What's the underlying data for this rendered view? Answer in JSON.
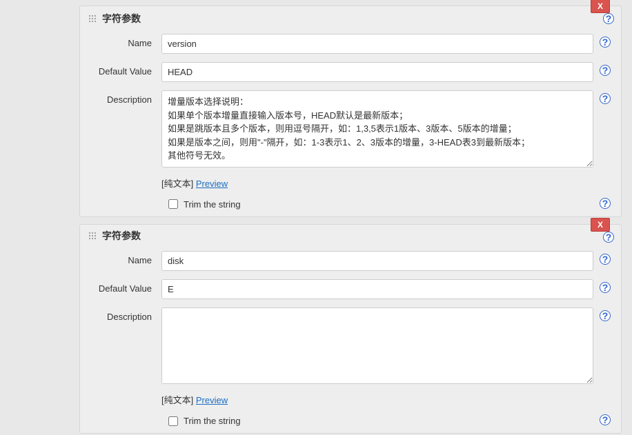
{
  "labels": {
    "section_title": "字符参数",
    "name": "Name",
    "default_value": "Default Value",
    "description": "Description",
    "plain_text": "[纯文本]",
    "preview": "Preview",
    "trim": "Trim the string",
    "delete": "X"
  },
  "params": [
    {
      "name_value": "version",
      "default_value": "HEAD",
      "description": "增量版本选择说明：\n如果单个版本增量直接输入版本号，HEAD默认是最新版本；\n如果是跳版本且多个版本，则用逗号隔开，如：1,3,5表示1版本、3版本、5版本的增量；\n如果是版本之间，则用\"-\"隔开，如：1-3表示1、2、3版本的增量，3-HEAD表3到最新版本；\n其他符号无效。",
      "trim_checked": false
    },
    {
      "name_value": "disk",
      "default_value": "E",
      "description": "",
      "trim_checked": false
    }
  ]
}
